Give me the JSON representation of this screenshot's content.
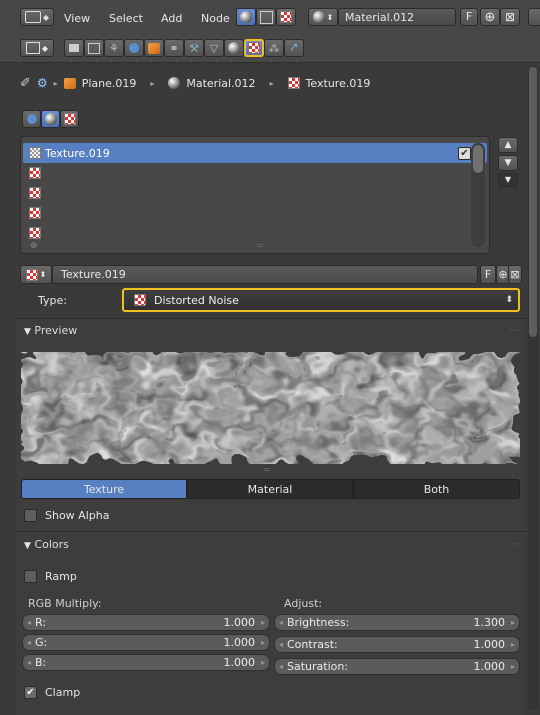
{
  "header": {
    "menus": [
      "View",
      "Select",
      "Add",
      "Node"
    ],
    "material_name": "Material.012",
    "fake_user_label": "F"
  },
  "breadcrumb": {
    "items": [
      "Plane.019",
      "Material.012",
      "Texture.019"
    ]
  },
  "texture_list": {
    "items": [
      "Texture.019",
      "",
      "",
      "",
      ""
    ],
    "selected_index": 0
  },
  "datablock": {
    "name": "Texture.019",
    "fake_user_label": "F"
  },
  "type_field": {
    "label": "Type:",
    "value": "Distorted Noise"
  },
  "preview": {
    "title": "Preview",
    "tabs": [
      "Texture",
      "Material",
      "Both"
    ],
    "active_tab": 0,
    "show_alpha_label": "Show Alpha"
  },
  "colors": {
    "title": "Colors",
    "ramp_label": "Ramp",
    "rgb_multiply_label": "RGB Multiply:",
    "adjust_label": "Adjust:",
    "r": {
      "label": "R:",
      "value": "1.000"
    },
    "g": {
      "label": "G:",
      "value": "1.000"
    },
    "b": {
      "label": "B:",
      "value": "1.000"
    },
    "brightness": {
      "label": "Brightness:",
      "value": "1.300"
    },
    "contrast": {
      "label": "Contrast:",
      "value": "1.000"
    },
    "saturation": {
      "label": "Saturation:",
      "value": "1.000"
    },
    "clamp_label": "Clamp"
  },
  "colors_theme": {
    "accent_highlight": "#f0c020",
    "selection_blue": "#5680c2",
    "panel_bg": "#3a3a3a"
  }
}
